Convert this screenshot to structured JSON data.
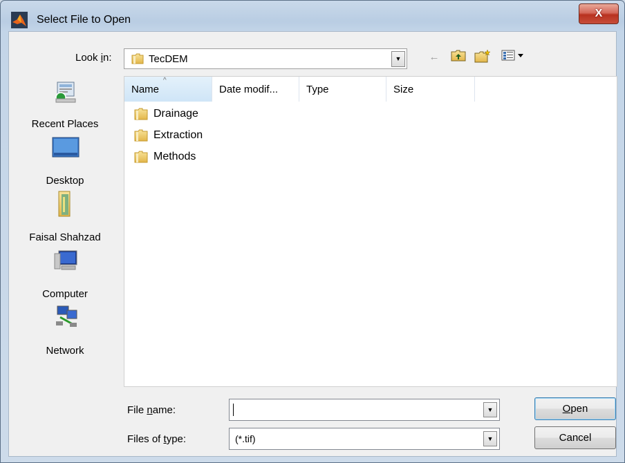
{
  "window": {
    "title": "Select File to Open",
    "close_glyph": "X"
  },
  "look_in": {
    "label_prefix": "Look ",
    "label_accel": "i",
    "label_suffix": "n:",
    "value": "TecDEM"
  },
  "toolbar": {
    "back_glyph": "←",
    "up_glyph": "↑",
    "new_folder_glyph": "✱",
    "view_glyph": "▦▾"
  },
  "places": [
    {
      "label": "Recent Places",
      "icon": "recent-places-icon"
    },
    {
      "label": "Desktop",
      "icon": "desktop-icon"
    },
    {
      "label": "Faisal Shahzad",
      "icon": "user-folder-icon"
    },
    {
      "label": "Computer",
      "icon": "computer-icon"
    },
    {
      "label": "Network",
      "icon": "network-icon"
    }
  ],
  "columns": [
    "Name",
    "Date modif...",
    "Type",
    "Size"
  ],
  "files": [
    {
      "name": "Drainage",
      "icon": "folder-icon"
    },
    {
      "name": "Extraction",
      "icon": "folder-icon"
    },
    {
      "name": "Methods",
      "icon": "folder-icon"
    }
  ],
  "file_name": {
    "label_prefix": "File ",
    "label_accel": "n",
    "label_suffix": "ame:",
    "value": ""
  },
  "file_type": {
    "label_prefix": "Files of ",
    "label_accel": "t",
    "label_suffix": "ype:",
    "value": "(*.tif)"
  },
  "buttons": {
    "open_accel": "O",
    "open_rest": "pen",
    "cancel": "Cancel"
  },
  "colors": {
    "title_bg": "#b9cde3",
    "close_red": "#c74d3a",
    "folder_yellow": "#f2cf63"
  }
}
